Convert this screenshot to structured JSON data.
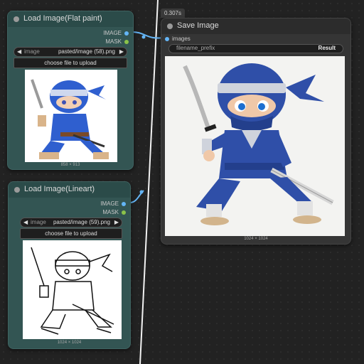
{
  "nodes": {
    "flat": {
      "title": "Load Image(Flat paint)",
      "outputs": [
        "IMAGE",
        "MASK"
      ],
      "image_widget": {
        "name": "image",
        "value": "pasted/image (58).png"
      },
      "upload_label": "choose file to upload",
      "dims": "858 × 913"
    },
    "lineart": {
      "title": "Load Image(Lineart)",
      "outputs": [
        "IMAGE",
        "MASK"
      ],
      "image_widget": {
        "name": "image",
        "value": "pasted/image (59).png"
      },
      "upload_label": "choose file to upload",
      "dims": "1024 × 1024"
    },
    "save": {
      "exec_time": "0.307s",
      "title": "Save Image",
      "inputs": [
        "images"
      ],
      "prefix_widget": {
        "name": "filename_prefix",
        "value": "Result"
      },
      "dims": "1024 × 1024"
    }
  },
  "colors": {
    "image_port": "#64b5f6",
    "mask_port": "#8bc34a",
    "link": "#64b5f6",
    "teal_node": "#335553",
    "gray_node": "#353535",
    "ninja_blue": "#2f4fa8"
  },
  "icons": [
    "left-arrow-icon",
    "right-arrow-icon",
    "node-status-dot-icon"
  ]
}
